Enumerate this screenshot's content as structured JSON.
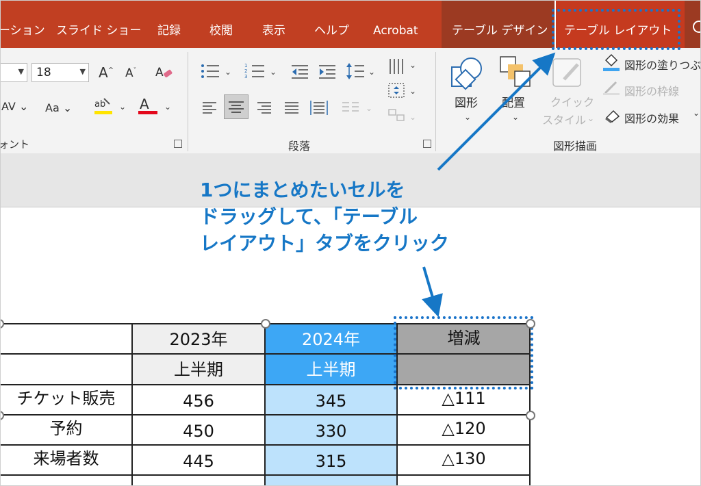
{
  "tabs": {
    "slideshow_partial": "ーション",
    "slideshow": "スライド ショー",
    "record": "記録",
    "review": "校閲",
    "view": "表示",
    "help": "ヘルプ",
    "acrobat": "Acrobat",
    "table_design": "テーブル デザイン",
    "table_layout": "テーブル レイアウト"
  },
  "font_group": {
    "font_size": "18",
    "label_partial": "ォント"
  },
  "paragraph_group": {
    "label": "段落"
  },
  "drawing_group": {
    "shapes_label": "図形",
    "arrange_label": "配置",
    "quick_styles_label_1": "クイック",
    "quick_styles_label_2": "スタイル",
    "shape_fill": "図形の塗りつぶ",
    "shape_outline": "図形の枠線",
    "shape_effects": "図形の効果",
    "label": "図形描画"
  },
  "callout": {
    "line1": "1つにまとめたいセルを",
    "line2": "ドラッグして、「テーブル",
    "line3": "レイアウト」タブをクリック"
  },
  "table": {
    "header_row1": [
      "",
      "2023年",
      "2024年",
      "増減"
    ],
    "header_row2": [
      "",
      "上半期",
      "上半期",
      ""
    ],
    "rows": [
      [
        "チケット販売",
        "456",
        "345",
        "△111"
      ],
      [
        "予約",
        "450",
        "330",
        "△120"
      ],
      [
        "来場者数",
        "445",
        "315",
        "△130"
      ]
    ]
  },
  "colors": {
    "tab_bar": "#c13f22",
    "context_tab_bar": "#9c3a22",
    "callout_blue": "#1677c6",
    "header_gray": "#efefef",
    "header_blue": "#3da7f5",
    "selected_gray": "#a6a6a6",
    "column_light_blue": "#bde2fc"
  }
}
